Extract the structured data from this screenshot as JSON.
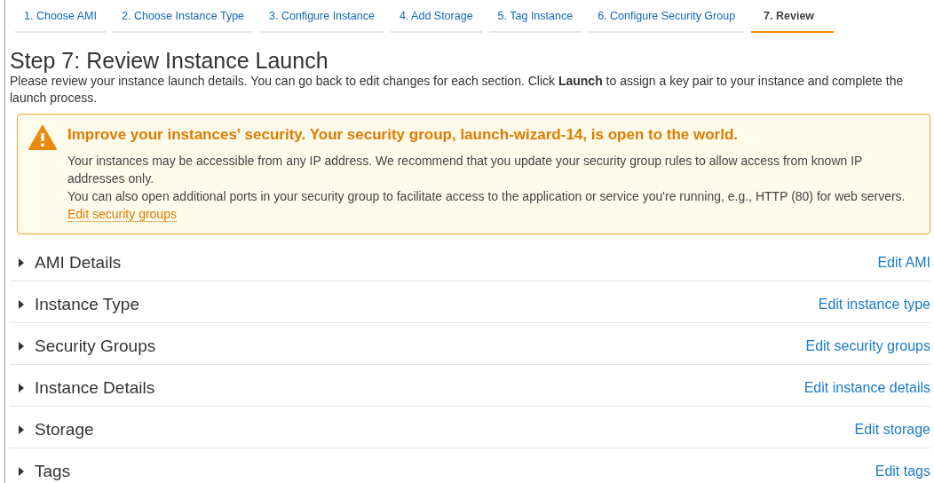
{
  "wizard_steps": [
    {
      "label": "1. Choose AMI",
      "selected": false
    },
    {
      "label": "2. Choose Instance Type",
      "selected": false
    },
    {
      "label": "3. Configure Instance",
      "selected": false
    },
    {
      "label": "4. Add Storage",
      "selected": false
    },
    {
      "label": "5. Tag Instance",
      "selected": false
    },
    {
      "label": "6. Configure Security Group",
      "selected": false
    },
    {
      "label": "7. Review",
      "selected": true
    }
  ],
  "page_title": "Step 7: Review Instance Launch",
  "intro": "Please review your instance launch details. You can go back to edit changes for each section. Click **Launch** to assign a key pair to your instance and complete the launch process.",
  "warning": {
    "title": "Improve your instances' security. Your security group, launch-wizard-14, is open to the world.",
    "message": "Your instances may be accessible from any IP address. We recommend that you update your security group rules to allow access from known IP addresses only.",
    "detail": "You can also open additional ports in your security group to facilitate access to the application or service you're running, e.g., HTTP (80) for web servers.",
    "link": "Edit security groups"
  },
  "sections": [
    {
      "title": "AMI Details",
      "action": "Edit AMI",
      "expanded": false
    },
    {
      "title": "Instance Type",
      "action": "Edit instance type",
      "expanded": false
    },
    {
      "title": "Security Groups",
      "action": "Edit security groups",
      "expanded": false
    },
    {
      "title": "Instance Details",
      "action": "Edit instance details",
      "expanded": false
    },
    {
      "title": "Storage",
      "action": "Edit storage",
      "expanded": false
    },
    {
      "title": "Tags",
      "action": "Edit tags",
      "expanded": false
    }
  ]
}
